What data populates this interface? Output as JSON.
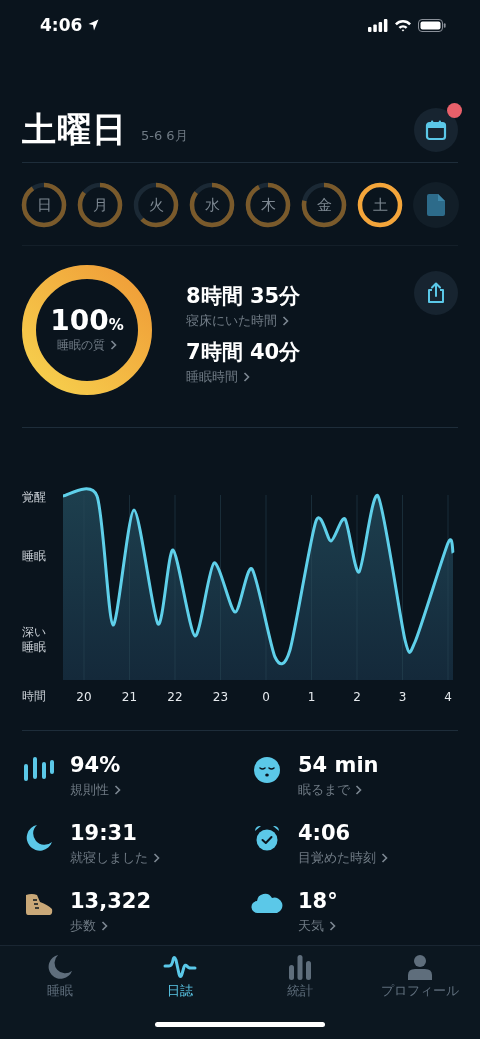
{
  "status_bar": {
    "time": "4:06"
  },
  "header": {
    "title": "土曜日",
    "subtitle": "5-6 6月",
    "calendar_notification": true
  },
  "days": [
    {
      "label": "日",
      "level": 0.9,
      "selected": false
    },
    {
      "label": "月",
      "level": 0.85,
      "selected": false
    },
    {
      "label": "火",
      "level": 0.62,
      "selected": false
    },
    {
      "label": "水",
      "level": 0.85,
      "selected": false
    },
    {
      "label": "木",
      "level": 0.92,
      "selected": false
    },
    {
      "label": "金",
      "level": 0.78,
      "selected": false
    },
    {
      "label": "土",
      "level": 1,
      "selected": true
    }
  ],
  "quality": {
    "value": "100",
    "unit": "%",
    "label": "睡眠の質",
    "level": 1
  },
  "durations": [
    {
      "value": "8時間 35分",
      "label": "寝床にいた時間"
    },
    {
      "value": "7時間 40分",
      "label": "睡眠時間"
    }
  ],
  "chart": {
    "stage_labels": [
      "覚醒",
      "睡眠",
      "深い睡眠"
    ],
    "axis_label": "時間",
    "hour_labels": [
      "20",
      "21",
      "22",
      "23",
      "0",
      "1",
      "2",
      "3",
      "4"
    ]
  },
  "stats": [
    {
      "kind": "regularity",
      "value": "94%",
      "label": "規則性"
    },
    {
      "kind": "latency",
      "value": "54 min",
      "label": "眠るまで"
    },
    {
      "kind": "bedtime",
      "value": "19:31",
      "label": "就寝しました"
    },
    {
      "kind": "wake",
      "value": "4:06",
      "label": "目覚めた時刻"
    },
    {
      "kind": "steps",
      "value": "13,322",
      "label": "歩数"
    },
    {
      "kind": "weather",
      "value": "18°",
      "label": "天気"
    }
  ],
  "tab_bar": [
    {
      "kind": "sleep",
      "label": "睡眠",
      "selected": false
    },
    {
      "kind": "journal",
      "label": "日誌",
      "selected": true
    },
    {
      "kind": "stats",
      "label": "統計",
      "selected": false
    },
    {
      "kind": "profile",
      "label": "プロフィール",
      "selected": false
    }
  ]
}
